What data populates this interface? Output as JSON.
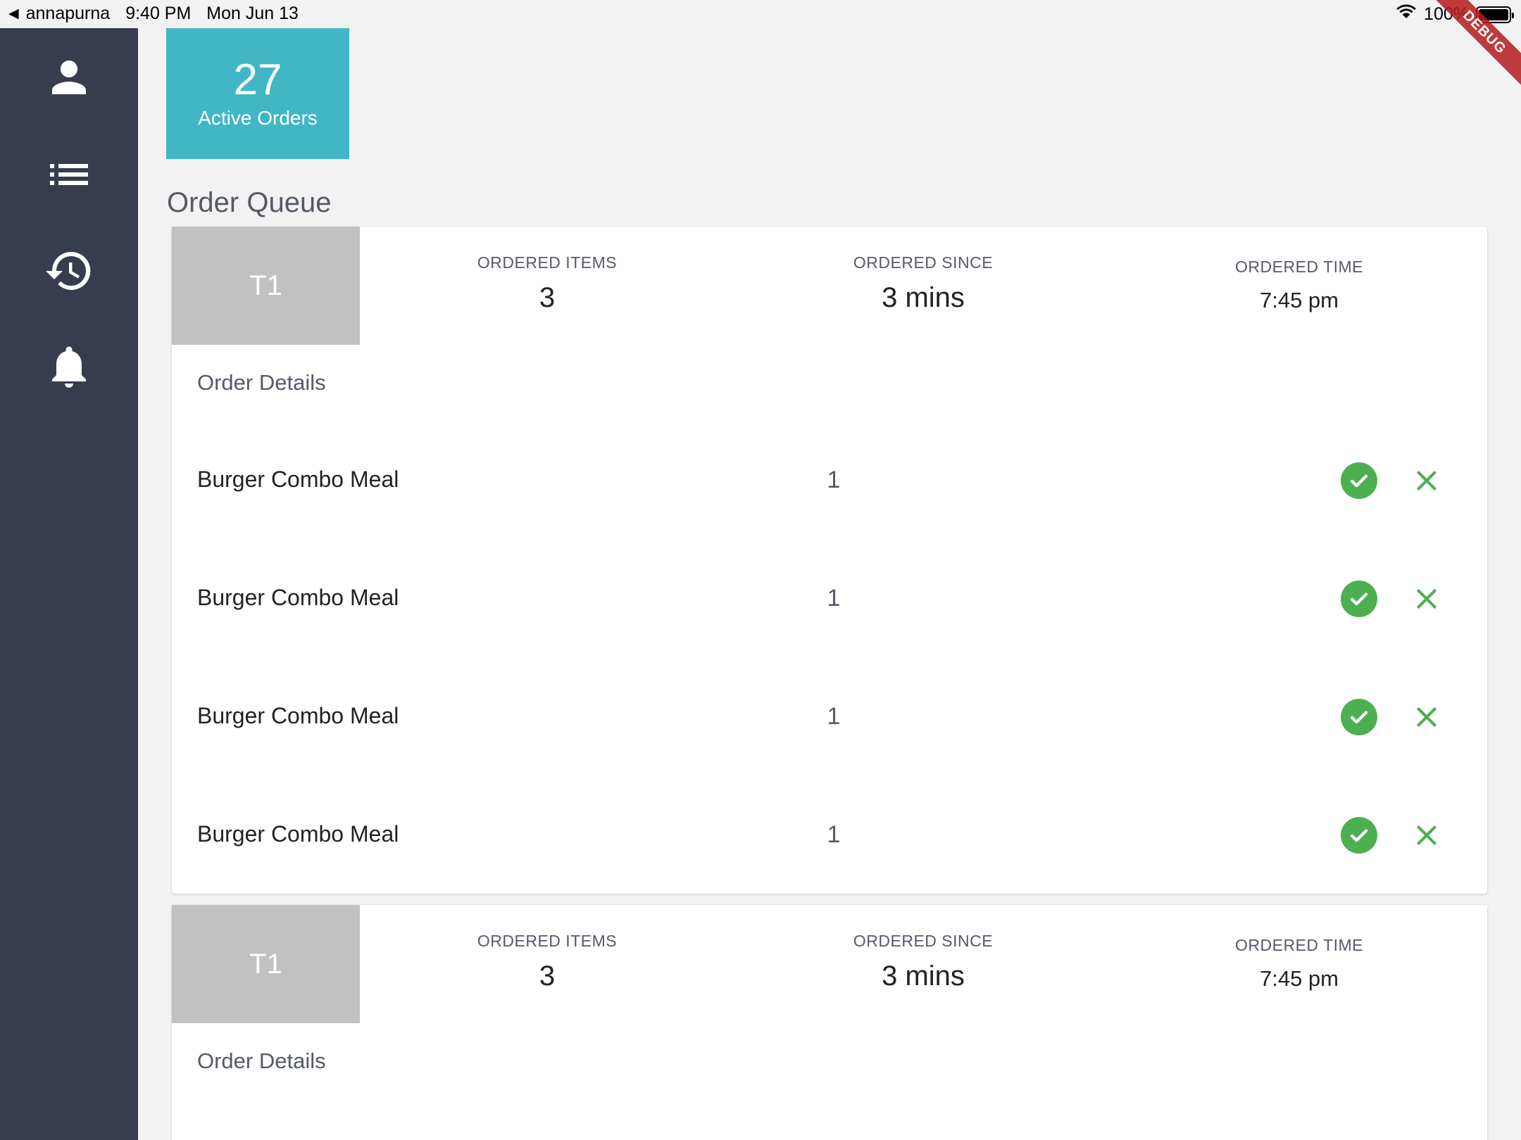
{
  "status_bar": {
    "back_app": "annapurna",
    "time": "9:40 PM",
    "date": "Mon Jun 13",
    "battery": "100%",
    "debug_label": "DEBUG"
  },
  "sidebar": {
    "items": [
      {
        "icon": "person-icon"
      },
      {
        "icon": "list-icon"
      },
      {
        "icon": "history-icon"
      },
      {
        "icon": "bell-icon"
      }
    ]
  },
  "active_orders": {
    "count": "27",
    "label": "Active Orders"
  },
  "queue_title": "Order Queue",
  "orders": [
    {
      "table": "T1",
      "ordered_items_label": "ORDERED ITEMS",
      "ordered_items": "3",
      "ordered_since_label": "ORDERED SINCE",
      "ordered_since": "3 mins",
      "ordered_time_label": "ORDERED TIME",
      "ordered_time": "7:45 pm",
      "details_heading": "Order Details",
      "items": [
        {
          "name": "Burger Combo Meal",
          "qty": "1"
        },
        {
          "name": "Burger Combo Meal",
          "qty": "1"
        },
        {
          "name": "Burger Combo Meal",
          "qty": "1"
        },
        {
          "name": "Burger Combo Meal",
          "qty": "1"
        }
      ]
    },
    {
      "table": "T1",
      "ordered_items_label": "ORDERED ITEMS",
      "ordered_items": "3",
      "ordered_since_label": "ORDERED SINCE",
      "ordered_since": "3 mins",
      "ordered_time_label": "ORDERED TIME",
      "ordered_time": "7:45 pm",
      "details_heading": "Order Details",
      "items": []
    }
  ],
  "colors": {
    "sidebar": "#373d4e",
    "active_tile": "#41b7c6",
    "accept": "#4caf50",
    "table_badge": "#c1c1c1"
  }
}
